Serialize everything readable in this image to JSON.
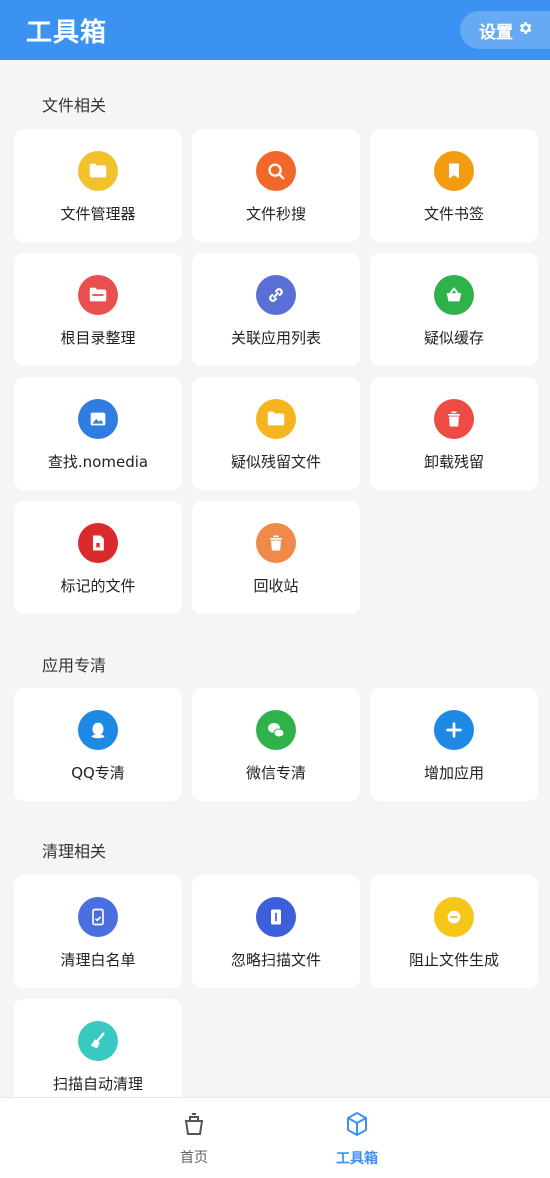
{
  "header": {
    "title": "工具箱",
    "settings_label": "设置"
  },
  "sections": [
    {
      "title": "文件相关",
      "items": [
        {
          "label": "文件管理器",
          "icon": "folder-icon",
          "color": "#f2c12e"
        },
        {
          "label": "文件秒搜",
          "icon": "search-icon",
          "color": "#f2682a"
        },
        {
          "label": "文件书签",
          "icon": "bookmark-icon",
          "color": "#f39c12"
        },
        {
          "label": "根目录整理",
          "icon": "folder-open-icon",
          "color": "#ea4f4f"
        },
        {
          "label": "关联应用列表",
          "icon": "link-icon",
          "color": "#5a6fd6"
        },
        {
          "label": "疑似缓存",
          "icon": "basket-icon",
          "color": "#2fb24a"
        },
        {
          "label": "查找.nomedia",
          "icon": "image-icon",
          "color": "#2f7de1"
        },
        {
          "label": "疑似残留文件",
          "icon": "folder-icon",
          "color": "#f5b51f"
        },
        {
          "label": "卸载残留",
          "icon": "trash-icon",
          "color": "#ee4b45"
        },
        {
          "label": "标记的文件",
          "icon": "marked-file-icon",
          "color": "#d92b2b"
        },
        {
          "label": "回收站",
          "icon": "trash-icon",
          "color": "#f08a4b"
        }
      ]
    },
    {
      "title": "应用专清",
      "items": [
        {
          "label": "QQ专清",
          "icon": "qq-icon",
          "color": "#1e88e5"
        },
        {
          "label": "微信专清",
          "icon": "wechat-icon",
          "color": "#2fb24a"
        },
        {
          "label": "增加应用",
          "icon": "plus-icon",
          "color": "#1e88e5"
        }
      ]
    },
    {
      "title": "清理相关",
      "items": [
        {
          "label": "清理白名单",
          "icon": "whitelist-icon",
          "color": "#4a6fe0"
        },
        {
          "label": "忽略扫描文件",
          "icon": "ignore-file-icon",
          "color": "#3d5fdc"
        },
        {
          "label": "阻止文件生成",
          "icon": "block-icon",
          "color": "#f5c518"
        },
        {
          "label": "扫描自动清理",
          "icon": "broom-icon",
          "color": "#38c9c0"
        }
      ]
    }
  ],
  "bottom_nav": {
    "home_label": "首页",
    "toolbox_label": "工具箱",
    "active_color": "#3b92f0"
  }
}
